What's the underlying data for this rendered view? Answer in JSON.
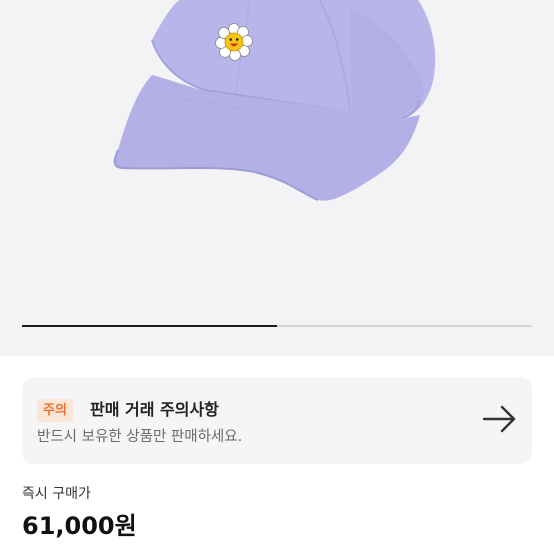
{
  "product_image": {
    "icon": "flower-smile-patch-icon",
    "cap_color": "#b4b2e8"
  },
  "carousel": {
    "progress": 0.5
  },
  "notice": {
    "badge": "주의",
    "title": "판매 거래 주의사항",
    "subtitle": "반드시 보유한 상품만 판매하세요.",
    "arrow_icon": "arrow-right-icon",
    "badge_color": "#f0702d"
  },
  "price": {
    "label": "즉시 구매가",
    "value": "61,000원"
  }
}
